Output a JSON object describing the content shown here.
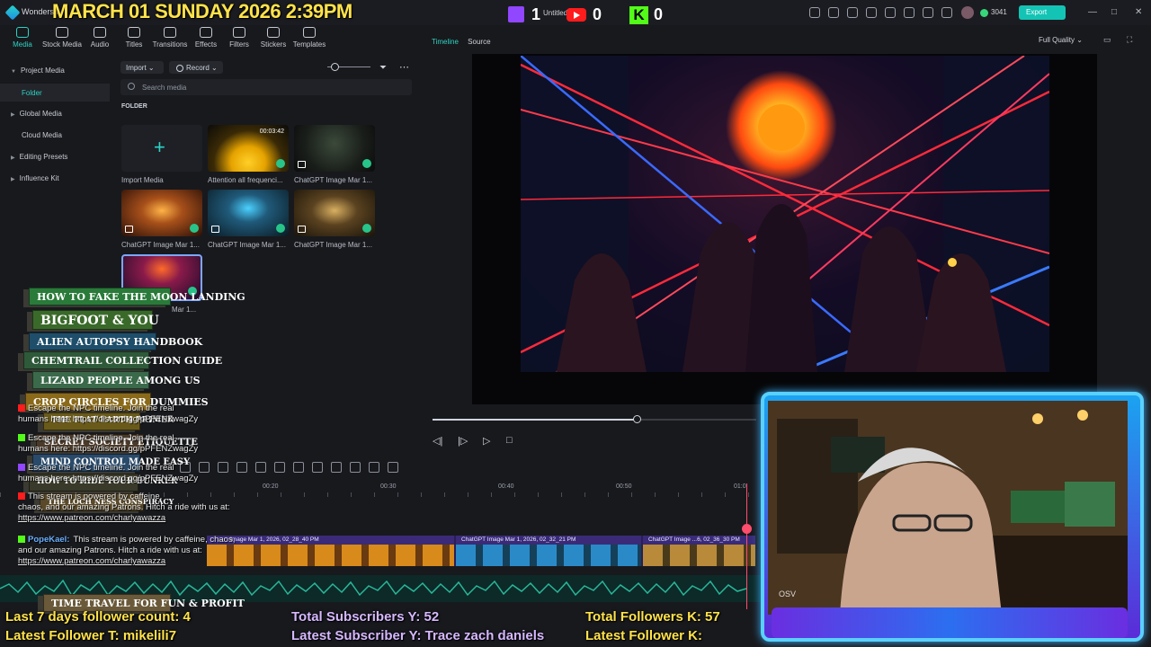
{
  "window": {
    "app_name": "Wondersh",
    "doc_name": "Untitled",
    "credits": "3041",
    "export_label": "Export",
    "minimize": "—",
    "maximize": "□",
    "close": "✕"
  },
  "overlay_top": {
    "date_time": "MARCH 01 SUNDAY 2026 2:39PM",
    "twitch_count": "1",
    "youtube_count": "0",
    "kick_letter": "K",
    "kick_count": "0"
  },
  "toolbar": {
    "items": [
      {
        "label": "Media",
        "icon": "media-icon"
      },
      {
        "label": "Stock Media",
        "icon": "stock-media-icon"
      },
      {
        "label": "Audio",
        "icon": "audio-icon"
      },
      {
        "label": "Titles",
        "icon": "titles-icon"
      },
      {
        "label": "Transitions",
        "icon": "transitions-icon"
      },
      {
        "label": "Effects",
        "icon": "effects-icon"
      },
      {
        "label": "Filters",
        "icon": "filters-icon"
      },
      {
        "label": "Stickers",
        "icon": "stickers-icon"
      },
      {
        "label": "Templates",
        "icon": "templates-icon"
      }
    ]
  },
  "leftnav": {
    "project_media": "Project Media",
    "folder": "Folder",
    "global_media": "Global Media",
    "cloud_media": "Cloud Media",
    "editing_presets": "Editing Presets",
    "influence_kit": "Influence Kit"
  },
  "media": {
    "import_label": "Import",
    "record_label": "Record",
    "search_placeholder": "Search media",
    "folder_heading": "FOLDER",
    "tiles": [
      {
        "caption": "Import Media"
      },
      {
        "caption": "Attention all frequenci...",
        "duration": "00:03:42"
      },
      {
        "caption": "ChatGPT Image Mar 1..."
      },
      {
        "caption": "ChatGPT Image Mar 1..."
      },
      {
        "caption": "ChatGPT Image Mar 1..."
      },
      {
        "caption": "ChatGPT Image Mar 1..."
      },
      {
        "caption": "Mar 1..."
      }
    ]
  },
  "player": {
    "tab_timeline": "Timeline",
    "tab_source": "Source",
    "quality": "Full Quality",
    "progress": 0.63
  },
  "timeline": {
    "ruler": [
      "00:20",
      "00:30",
      "00:40",
      "00:50",
      "01:0"
    ],
    "clips": [
      "Image Mar 1, 2026, 02_28_40 PM",
      "ChatGPT Image Mar 1, 2026, 02_32_21 PM",
      "ChatGPT Image ...6, 02_36_30 PM"
    ]
  },
  "books": [
    "HOW TO FAKE THE MOON LANDING",
    "BIGFOOT & YOU",
    "ALIEN AUTOPSY HANDBOOK",
    "CHEMTRAIL COLLECTION GUIDE",
    "LIZARD PEOPLE AMONG US",
    "CROP CIRCLES FOR DUMMIES",
    "THE FLAT EARTH PRIMER",
    "SECRET SOCIETY ETIQUETTE",
    "MIND CONTROL MADE EASY",
    "HOW TO HIDE YOUR BUNKER",
    "THE LOCH NESS CONSPIRACY",
    "TIME TRAVEL FOR FUN & PROFIT"
  ],
  "chat": [
    {
      "line1": "Escape the NPC timeline. Join the real",
      "line2": "humans here: https://discord.gg/pPFENZwagZy"
    },
    {
      "line1": "Escape the NPC timeline. Join the real",
      "line2": "humans here: https://discord.gg/pPFENZwagZy"
    },
    {
      "line1": "Escape the NPC timeline. Join the real",
      "line2": "humans here: https://discord.gg/pPFENZwagZy"
    },
    {
      "line1": "This stream is powered by caffeine,",
      "line2": "chaos, and our amazing Patrons. Hitch a ride with us at:",
      "line3": "https://www.patreon.com/charlyawazza"
    },
    {
      "who": "PopeKael:",
      "line1": "This stream is powered by caffeine, chaos,",
      "line2": "and our amazing Patrons. Hitch a ride with us at:",
      "line3": "https://www.patreon.com/charlyawazza"
    }
  ],
  "stats": {
    "last7": "Last 7 days follower count: 4",
    "latest_follower_t": "Latest Follower T: mikelili7",
    "subs_y": "Total Subscribers Y: 52",
    "latest_sub_y": "Latest Subscriber Y: Trace zach daniels",
    "followers_k": "Total Followers K: 57",
    "latest_follower_k": "Latest Follower K:"
  },
  "cam": {
    "watermark": "OSV"
  },
  "colors": {
    "accent": "#2ed3c4",
    "export": "#13c4b5",
    "overlay_yellow": "#ffe34a",
    "playhead": "#ff4d6d"
  }
}
